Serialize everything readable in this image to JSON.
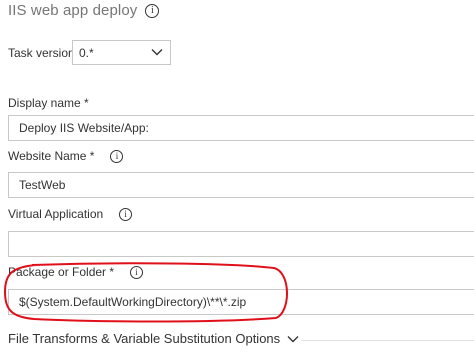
{
  "header": {
    "title": "IIS web app deploy",
    "info_icon": "info-icon"
  },
  "task_version": {
    "label": "Task version",
    "value": "0.*",
    "icon": "chevron-down-icon"
  },
  "display_name": {
    "label": "Display name *",
    "value": "Deploy IIS Website/App:"
  },
  "website_name": {
    "label": "Website Name *",
    "value": "TestWeb",
    "info_icon": "info-icon"
  },
  "virtual_application": {
    "label": "Virtual Application",
    "value": "",
    "info_icon": "info-icon"
  },
  "package_or_folder": {
    "label": "Package or Folder *",
    "value": "$(System.DefaultWorkingDirectory)\\**\\*.zip",
    "info_icon": "info-icon",
    "highlight_color": "#e0101a"
  },
  "section": {
    "title": "File Transforms & Variable Substitution Options",
    "icon": "chevron-down-icon"
  }
}
